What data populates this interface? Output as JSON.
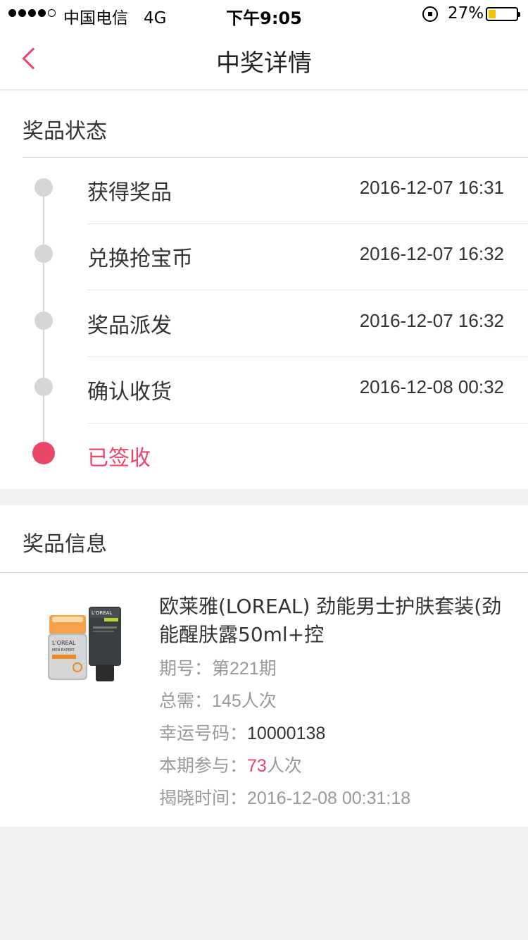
{
  "status_bar": {
    "carrier": "中国电信",
    "network": "4G",
    "time": "下午9:05",
    "battery": "27%",
    "battery_level": 0.27,
    "battery_color": "#f5c200"
  },
  "nav": {
    "title": "中奖详情",
    "back_icon": "chevron-left-icon",
    "accent": "#e8476a"
  },
  "prize_status": {
    "title": "奖品状态",
    "steps": [
      {
        "label": "获得奖品",
        "time": "2016-12-07 16:31"
      },
      {
        "label": "兑换抢宝币",
        "time": "2016-12-07 16:32"
      },
      {
        "label": "奖品派发",
        "time": "2016-12-07 16:32"
      },
      {
        "label": "确认收货",
        "time": "2016-12-08 00:32"
      },
      {
        "label": "已签收",
        "time": ""
      }
    ],
    "current_step": 5
  },
  "prize_info": {
    "title": "奖品信息",
    "product_name": "欧莱雅(LOREAL) 劲能男士护肤套装(劲能醒肤露50ml+控",
    "image_brand_text": "L'OREAL",
    "image_sub_text": "MEN EXPERT",
    "period_label": "期号：",
    "period_value": "第221期",
    "total_label": "总需：",
    "total_value": "145人次",
    "lucky_label": "幸运号码：",
    "lucky_value": "10000138",
    "participate_label": "本期参与：",
    "participate_count": "73",
    "participate_unit": "人次",
    "reveal_label": "揭晓时间：",
    "reveal_value": "2016-12-08 00:31:18"
  }
}
